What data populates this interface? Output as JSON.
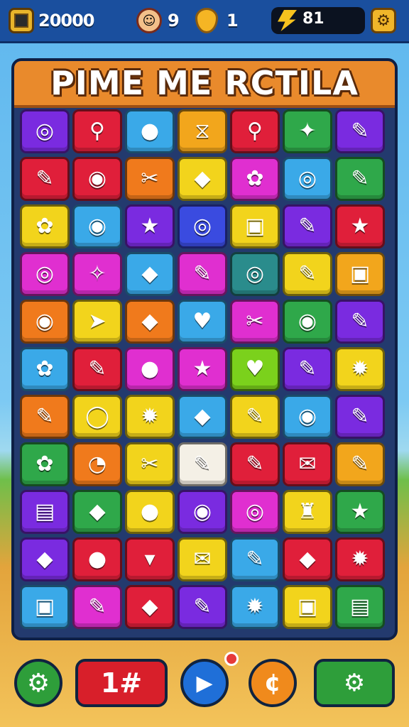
{
  "hud": {
    "score": "20000",
    "lives": "9",
    "coins": "1",
    "energy": "81",
    "level_badge_icon": "shield-badge-icon",
    "settings_icon": "gear-icon"
  },
  "board": {
    "title": "PIME ME RCTILA",
    "tiles": [
      {
        "color": "#7a2be0",
        "icon": "◎"
      },
      {
        "color": "#e01f3a",
        "icon": "⚲"
      },
      {
        "color": "#3aa9e8",
        "icon": "●"
      },
      {
        "color": "#f2a61c",
        "icon": "⧖"
      },
      {
        "color": "#e01f3a",
        "icon": "⚲"
      },
      {
        "color": "#2fa84a",
        "icon": "✦"
      },
      {
        "color": "#7a2be0",
        "icon": "✎"
      },
      {
        "color": "#e01f3a",
        "icon": "✎"
      },
      {
        "color": "#e01f3a",
        "icon": "◉"
      },
      {
        "color": "#f07a1c",
        "icon": "✂"
      },
      {
        "color": "#f2d41c",
        "icon": "◆"
      },
      {
        "color": "#e02fd0",
        "icon": "✿"
      },
      {
        "color": "#3aa9e8",
        "icon": "◎"
      },
      {
        "color": "#2fa84a",
        "icon": "✎"
      },
      {
        "color": "#f2d41c",
        "icon": "✿"
      },
      {
        "color": "#3aa9e8",
        "icon": "◉"
      },
      {
        "color": "#7a2be0",
        "icon": "★"
      },
      {
        "color": "#3a4be0",
        "icon": "◎"
      },
      {
        "color": "#f2d41c",
        "icon": "▣"
      },
      {
        "color": "#7a2be0",
        "icon": "✎"
      },
      {
        "color": "#e01f3a",
        "icon": "★"
      },
      {
        "color": "#e02fd0",
        "icon": "◎"
      },
      {
        "color": "#e02fd0",
        "icon": "✧"
      },
      {
        "color": "#3aa9e8",
        "icon": "◆"
      },
      {
        "color": "#e02fd0",
        "icon": "✎"
      },
      {
        "color": "#2a8c8c",
        "icon": "◎"
      },
      {
        "color": "#f2d41c",
        "icon": "✎"
      },
      {
        "color": "#f2a61c",
        "icon": "▣"
      },
      {
        "color": "#f07a1c",
        "icon": "◉"
      },
      {
        "color": "#f2d41c",
        "icon": "➤"
      },
      {
        "color": "#f07a1c",
        "icon": "◆"
      },
      {
        "color": "#3aa9e8",
        "icon": "♥"
      },
      {
        "color": "#e02fd0",
        "icon": "✂"
      },
      {
        "color": "#2fa84a",
        "icon": "◉"
      },
      {
        "color": "#7a2be0",
        "icon": "✎"
      },
      {
        "color": "#3aa9e8",
        "icon": "✿"
      },
      {
        "color": "#e01f3a",
        "icon": "✎"
      },
      {
        "color": "#e02fd0",
        "icon": "●"
      },
      {
        "color": "#e02fd0",
        "icon": "★"
      },
      {
        "color": "#7bd11c",
        "icon": "♥"
      },
      {
        "color": "#7a2be0",
        "icon": "✎"
      },
      {
        "color": "#f2d41c",
        "icon": "✹"
      },
      {
        "color": "#f07a1c",
        "icon": "✎"
      },
      {
        "color": "#f2d41c",
        "icon": "◯"
      },
      {
        "color": "#f2d41c",
        "icon": "✹"
      },
      {
        "color": "#3aa9e8",
        "icon": "◆"
      },
      {
        "color": "#f2d41c",
        "icon": "✎"
      },
      {
        "color": "#3aa9e8",
        "icon": "◉"
      },
      {
        "color": "#7a2be0",
        "icon": "✎"
      },
      {
        "color": "#2fa84a",
        "icon": "✿"
      },
      {
        "color": "#f07a1c",
        "icon": "◔"
      },
      {
        "color": "#f2d41c",
        "icon": "✂"
      },
      {
        "color": "#f4f0e6",
        "icon": "✎"
      },
      {
        "color": "#e01f3a",
        "icon": "✎"
      },
      {
        "color": "#e01f3a",
        "icon": "✉"
      },
      {
        "color": "#f2a61c",
        "icon": "✎"
      },
      {
        "color": "#7a2be0",
        "icon": "▤"
      },
      {
        "color": "#2fa84a",
        "icon": "◆"
      },
      {
        "color": "#f2d41c",
        "icon": "●"
      },
      {
        "color": "#7a2be0",
        "icon": "◉"
      },
      {
        "color": "#e02fd0",
        "icon": "◎"
      },
      {
        "color": "#f2d41c",
        "icon": "♜"
      },
      {
        "color": "#2fa84a",
        "icon": "★"
      },
      {
        "color": "#7a2be0",
        "icon": "◆"
      },
      {
        "color": "#e01f3a",
        "icon": "●"
      },
      {
        "color": "#e01f3a",
        "icon": "▾"
      },
      {
        "color": "#f2d41c",
        "icon": "✉"
      },
      {
        "color": "#3aa9e8",
        "icon": "✎"
      },
      {
        "color": "#e01f3a",
        "icon": "◆"
      },
      {
        "color": "#e01f3a",
        "icon": "✹"
      },
      {
        "color": "#3aa9e8",
        "icon": "▣"
      },
      {
        "color": "#e02fd0",
        "icon": "✎"
      },
      {
        "color": "#e01f3a",
        "icon": "◆"
      },
      {
        "color": "#7a2be0",
        "icon": "✎"
      },
      {
        "color": "#3aa9e8",
        "icon": "✹"
      },
      {
        "color": "#f2d41c",
        "icon": "▣"
      },
      {
        "color": "#2fa84a",
        "icon": "▤"
      }
    ]
  },
  "bottom": {
    "settings_icon": "gear-icon",
    "moves_label": "1#",
    "play_icon": "play-icon",
    "coin_icon": "coin-icon",
    "toggle_icon": "gear-toggle-icon",
    "colors": {
      "green": "#2e9e3a",
      "red": "#d81f2a",
      "blue": "#1f6fd8",
      "orange": "#f08a1c"
    }
  }
}
